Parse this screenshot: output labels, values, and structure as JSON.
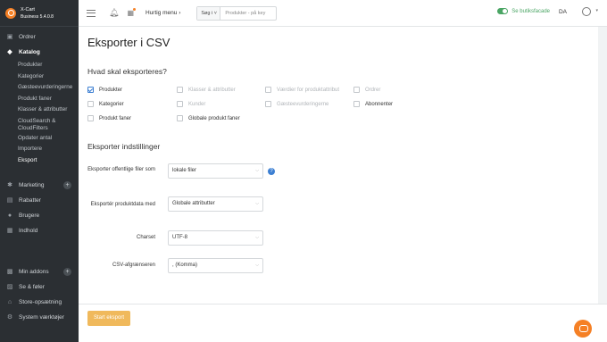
{
  "brand": {
    "name": "X-Cart",
    "edition": "Business 5.4.0.8"
  },
  "sidebar": {
    "orders": "Ordrer",
    "catalog": "Katalog",
    "catalog_items": [
      "Produkter",
      "Kategorier",
      "Gæsteevurderingerne",
      "Produkt faner",
      "Klasser & attributter",
      "CloudSearch & CloudFilters",
      "Opdater antal",
      "Importere",
      "Eksport"
    ],
    "marketing": "Marketing",
    "discounts": "Rabatter",
    "users": "Brugere",
    "content": "Indhold",
    "addons": "Min addons",
    "look": "Se & føler",
    "store_setup": "Store-opsætning",
    "system_tools": "System værktøjer"
  },
  "topbar": {
    "quick_menu": "Hurtig menu",
    "search_select": "Søg i",
    "search_placeholder": "Produkter - på key",
    "storefront": "Se butiksfacade",
    "language": "DA"
  },
  "page": {
    "title": "Eksporter i CSV",
    "what_title": "Hvad skal eksporteres?",
    "settings_title": "Eksporter indstillinger",
    "options": [
      {
        "label": "Produkter",
        "checked": true,
        "disabled": false
      },
      {
        "label": "Kategorier",
        "checked": false,
        "disabled": false
      },
      {
        "label": "Produkt faner",
        "checked": false,
        "disabled": false
      },
      {
        "label": "Klasser & attributter",
        "checked": false,
        "disabled": true
      },
      {
        "label": "Kunder",
        "checked": false,
        "disabled": true
      },
      {
        "label": "Globale produkt faner",
        "checked": false,
        "disabled": false
      },
      {
        "label": "Værdier for produktattribut",
        "checked": false,
        "disabled": true
      },
      {
        "label": "Gæsteevurderingerne",
        "checked": false,
        "disabled": true
      },
      {
        "label": "Ordrer",
        "checked": false,
        "disabled": true
      },
      {
        "label": "Abonnenter",
        "checked": false,
        "disabled": false
      }
    ],
    "fields": [
      {
        "label": "Eksporter offentlige filer som",
        "value": "lokale filer"
      },
      {
        "label": "Eksportér produktdata med",
        "value": "Globale attributter"
      },
      {
        "label": "Charset",
        "value": "UTF-8"
      },
      {
        "label": "CSV-afgrænseren",
        "value": ", (Komma)"
      }
    ],
    "start_button": "Start eksport"
  },
  "colors": {
    "sidebar_bg": "#2b2f33",
    "accent": "#f58025",
    "button": "#f0b95c",
    "checkbox": "#3c7fd2",
    "toggle": "#4aa564"
  }
}
